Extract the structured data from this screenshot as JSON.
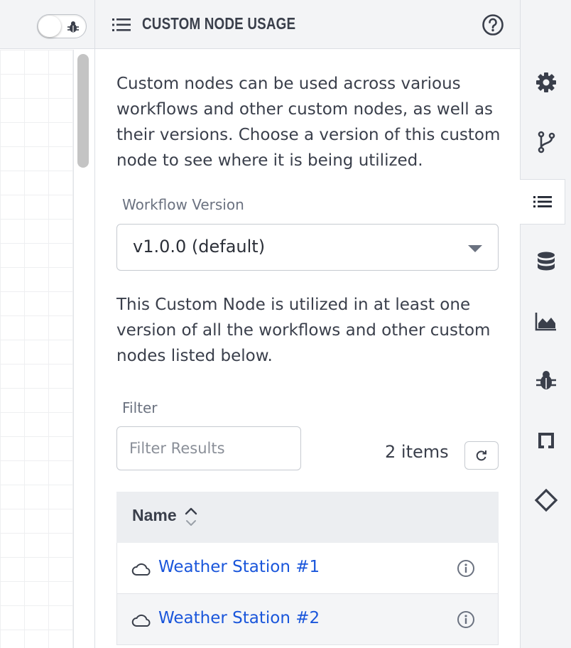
{
  "header": {
    "title": "CUSTOM NODE USAGE",
    "icon": "list-icon",
    "help_icon": "question-circle-icon"
  },
  "canvas": {
    "debug_toggle_icon": "bug-icon"
  },
  "body": {
    "intro": "Custom nodes can be used across various workflows and other custom nodes, as well as their versions. Choose a version of this custom node to see where it is being utilized.",
    "version_label": "Workflow Version",
    "version_value": "v1.0.0 (default)",
    "usage_text": "This Custom Node is utilized in at least one version of all the workflows and other custom nodes listed below.",
    "filter_label": "Filter",
    "filter_placeholder": "Filter Results",
    "filter_value": "",
    "items_count": "2 items"
  },
  "table": {
    "header_name": "Name",
    "rows": [
      {
        "name": "Weather Station #1",
        "icon": "cloud-icon"
      },
      {
        "name": "Weather Station #2",
        "icon": "cloud-icon"
      }
    ]
  },
  "rail": {
    "items": [
      "gear-icon",
      "branch-icon",
      "list-icon",
      "database-icon",
      "area-chart-icon",
      "bug-icon",
      "crop-icon",
      "code-icon"
    ],
    "active": "list-icon"
  },
  "colors": {
    "link": "#1a56db",
    "text": "#3a3f4b",
    "header_bg": "#f3f4f6"
  }
}
